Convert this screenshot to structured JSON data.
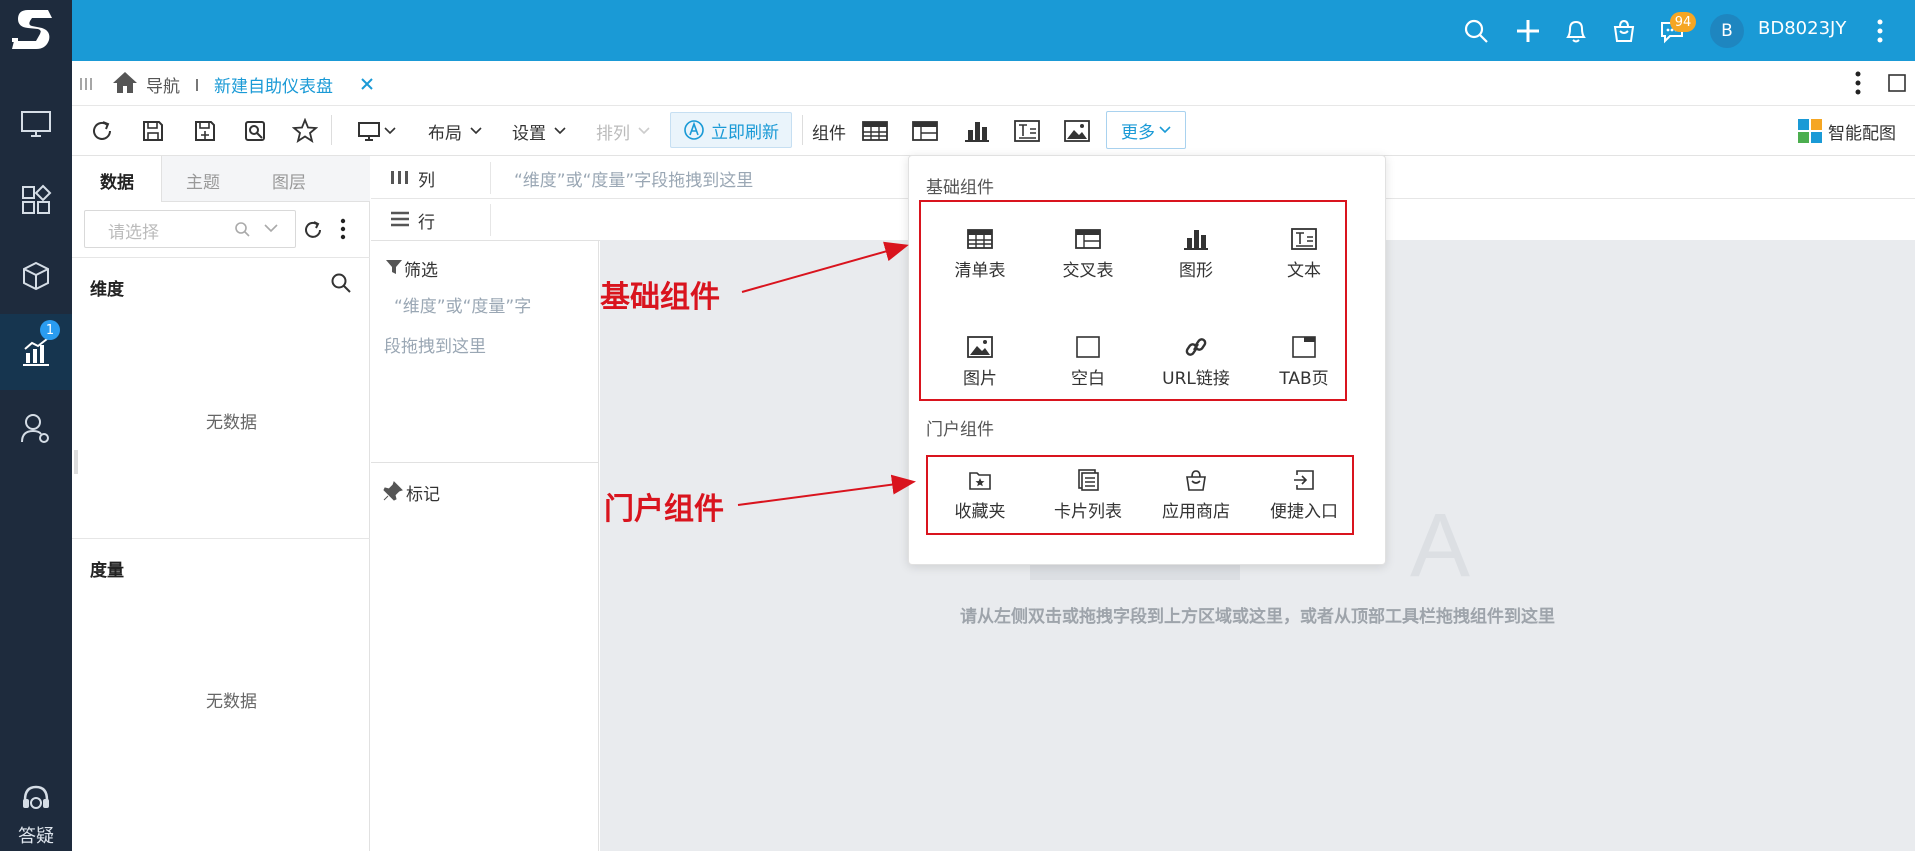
{
  "header": {
    "username": "BD8023JY",
    "avatar_letter": "B",
    "message_count": "94",
    "icons": [
      "search-icon",
      "plus-icon",
      "bell-icon",
      "bag-icon",
      "chat-icon",
      "more-vertical-icon"
    ]
  },
  "rail": {
    "badge_count": "1",
    "help_label": "答疑",
    "items": [
      "monitor-icon",
      "widgets-icon",
      "cube-icon",
      "chart-report-icon",
      "user-gear-icon"
    ]
  },
  "tabs": {
    "home_label": "导航",
    "active_tab": "新建自助仪表盘"
  },
  "toolbar": {
    "layout_label": "布局",
    "settings_label": "设置",
    "arrange_label": "排列",
    "refresh_label": "立即刷新",
    "component_label": "组件",
    "more_label": "更多",
    "smart_color_label": "智能配图"
  },
  "data_panel": {
    "tabs": [
      "数据",
      "主题",
      "图层"
    ],
    "search_placeholder": "请选择",
    "dimension_title": "维度",
    "measure_title": "度量",
    "empty_text": "无数据"
  },
  "fields": {
    "column_label": "列",
    "row_label": "行",
    "column_hint": "“维度”或“度量”字段拖拽到这里",
    "filter_label": "筛选",
    "filter_hint_line1": "“维度”或“度量”字",
    "filter_hint_line2": "段拖拽到这里",
    "mark_label": "标记"
  },
  "canvas": {
    "hint": "请从左侧双击或拖拽字段到上方区域或这里，或者从顶部工具栏拖拽组件到这里"
  },
  "popover": {
    "basic_title": "基础组件",
    "portal_title": "门户组件",
    "basic_items": [
      "清单表",
      "交叉表",
      "图形",
      "文本",
      "图片",
      "空白",
      "URL链接",
      "TAB页"
    ],
    "portal_items": [
      "收藏夹",
      "卡片列表",
      "应用商店",
      "便捷入口"
    ]
  },
  "annotations": {
    "basic_callout": "基础组件",
    "portal_callout": "门户组件",
    "color": "#d9141e"
  },
  "colors": {
    "header_blue": "#1a9ad6",
    "rail_dark": "#1e2b3d"
  }
}
